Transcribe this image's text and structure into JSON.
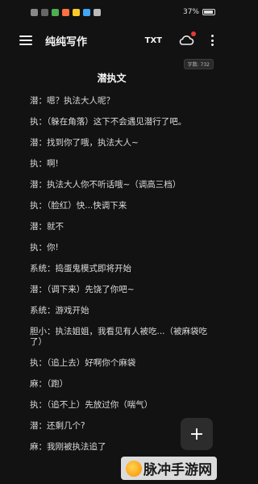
{
  "status_bar": {
    "left_icons": [
      "signal-icon",
      "hd-badge",
      "mail-icon",
      "app-icon",
      "app-icon",
      "app-icon",
      "wifi-icon"
    ],
    "right_text": "37%"
  },
  "app_bar": {
    "title": "纯纯写作",
    "txt_label": "TXT"
  },
  "word_count": "字数: 732",
  "document": {
    "title": "潜执文",
    "paragraphs": [
      "潜：嗯？执法大人呢？",
      "执：（躲在角落）这下不会遇见潜行了吧。",
      "潜：找到你了哦，执法大人~",
      "执：啊!",
      "潜：执法大人你不听话哦~（调高三档）",
      "执：（脸红）快...快调下来",
      "潜：就不",
      "执：你!",
      "系统：捣蛋鬼模式即将开始",
      "潜：（调下来）先饶了你吧~",
      "系统：游戏开始",
      "胆小：执法姐姐，我看见有人被吃...（被麻袋吃了）",
      "执：（追上去）好啊你个麻袋",
      "麻：（跑）",
      "执：（追不上）先放过你（喘气）",
      "潜：还剩几个?",
      "麻：我刚被执法追了"
    ]
  },
  "fab_label": "+",
  "watermark": "脉冲手游网",
  "colors": {
    "background": "#121212",
    "text": "#dcdcdc",
    "notification_dot": "#e53935"
  }
}
